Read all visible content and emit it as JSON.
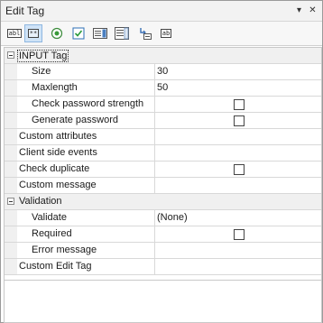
{
  "window": {
    "title": "Edit Tag",
    "dropdown_glyph": "▾",
    "close_glyph": "✕"
  },
  "toolbar": {
    "tools": [
      {
        "icon": "text-box-icon",
        "text": "abl"
      },
      {
        "icon": "password-box-icon",
        "text": "**"
      },
      {
        "icon": "radio-button-icon"
      },
      {
        "icon": "checkbox-icon"
      },
      {
        "icon": "select-list-icon"
      },
      {
        "icon": "listbox-icon"
      },
      {
        "icon": "hidden-field-icon"
      },
      {
        "icon": "label-icon",
        "text": "ab"
      }
    ],
    "active_index": 1
  },
  "grid": {
    "rows": [
      {
        "type": "category",
        "label": "INPUT Tag"
      },
      {
        "type": "prop",
        "indent": 2,
        "label": "Size",
        "value": "30"
      },
      {
        "type": "prop",
        "indent": 2,
        "label": "Maxlength",
        "value": "50"
      },
      {
        "type": "prop",
        "indent": 2,
        "label": "Check password strength",
        "checkbox": true,
        "checked": false
      },
      {
        "type": "prop",
        "indent": 2,
        "label": "Generate password",
        "checkbox": true,
        "checked": false
      },
      {
        "type": "prop",
        "indent": 1,
        "label": "Custom attributes",
        "value": ""
      },
      {
        "type": "prop",
        "indent": 1,
        "label": "Client side events",
        "value": ""
      },
      {
        "type": "prop",
        "indent": 1,
        "label": "Check duplicate",
        "checkbox": true,
        "checked": false
      },
      {
        "type": "prop",
        "indent": 1,
        "label": "Custom message",
        "value": ""
      },
      {
        "type": "category",
        "label": "Validation"
      },
      {
        "type": "prop",
        "indent": 2,
        "label": "Validate",
        "value": "(None)"
      },
      {
        "type": "prop",
        "indent": 2,
        "label": "Required",
        "checkbox": true,
        "checked": false
      },
      {
        "type": "prop",
        "indent": 2,
        "label": "Error message",
        "value": ""
      },
      {
        "type": "prop",
        "indent": 1,
        "label": "Custom Edit Tag",
        "value": ""
      }
    ]
  }
}
